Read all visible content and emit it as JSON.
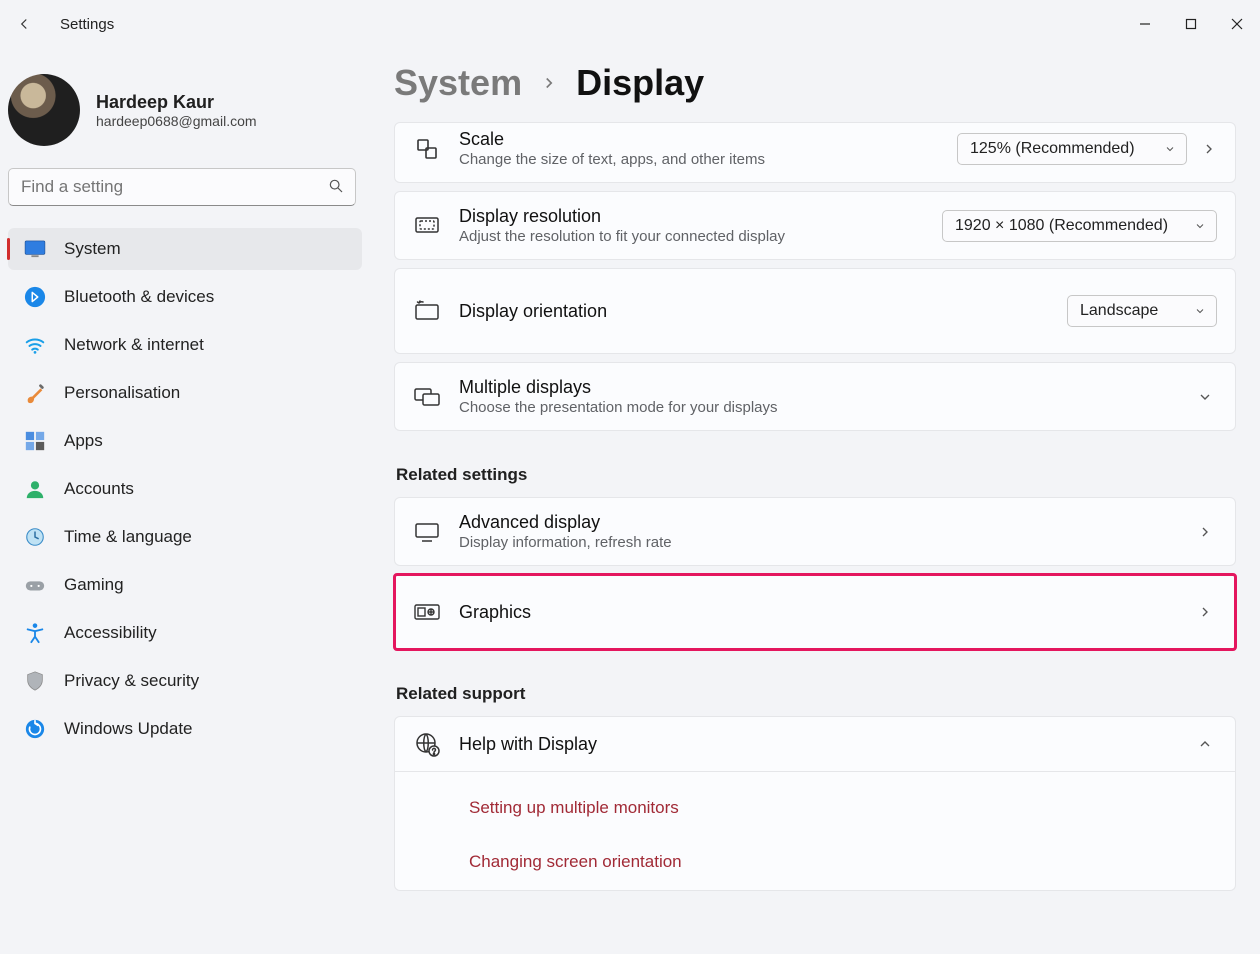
{
  "window": {
    "title": "Settings"
  },
  "user": {
    "name": "Hardeep Kaur",
    "email": "hardeep0688@gmail.com"
  },
  "search": {
    "placeholder": "Find a setting"
  },
  "sidebar": {
    "items": [
      {
        "label": "System"
      },
      {
        "label": "Bluetooth & devices"
      },
      {
        "label": "Network & internet"
      },
      {
        "label": "Personalisation"
      },
      {
        "label": "Apps"
      },
      {
        "label": "Accounts"
      },
      {
        "label": "Time & language"
      },
      {
        "label": "Gaming"
      },
      {
        "label": "Accessibility"
      },
      {
        "label": "Privacy & security"
      },
      {
        "label": "Windows Update"
      }
    ]
  },
  "breadcrumb": {
    "parent": "System",
    "current": "Display"
  },
  "cards": {
    "scale": {
      "title": "Scale",
      "sub": "Change the size of text, apps, and other items",
      "value": "125% (Recommended)"
    },
    "resolution": {
      "title": "Display resolution",
      "sub": "Adjust the resolution to fit your connected display",
      "value": "1920 × 1080 (Recommended)"
    },
    "orientation": {
      "title": "Display orientation",
      "value": "Landscape"
    },
    "multiple": {
      "title": "Multiple displays",
      "sub": "Choose the presentation mode for your displays"
    },
    "advanced": {
      "title": "Advanced display",
      "sub": "Display information, refresh rate"
    },
    "graphics": {
      "title": "Graphics"
    },
    "help": {
      "title": "Help with Display",
      "links": [
        "Setting up multiple monitors",
        "Changing screen orientation"
      ]
    }
  },
  "headings": {
    "related_settings": "Related settings",
    "related_support": "Related support"
  }
}
